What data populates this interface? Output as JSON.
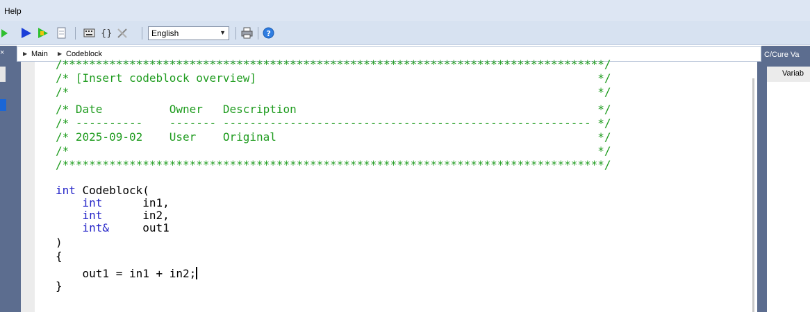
{
  "menubar": {
    "items": [
      "Help"
    ]
  },
  "toolbar": {
    "icons": [
      "play-green-icon",
      "play-blue-icon",
      "step-icon",
      "document-icon",
      "keyboard-icon",
      "braces-icon",
      "tools-icon",
      "printer-icon",
      "help-icon"
    ],
    "language": {
      "selected": "English"
    }
  },
  "breadcrumb": {
    "items": [
      "Main",
      "Codeblock"
    ]
  },
  "right_panel": {
    "title": "C/Cure Va",
    "tab": "Variab"
  },
  "editor": {
    "lines": [
      "/*********************************************************************************/",
      "/* [Insert codeblock overview]                                                   */",
      "/*                                                                               */",
      "/* Date          Owner   Description                                             */",
      "/* ----------    ------- ------------------------------------------------------- */",
      "/* 2025-09-02    User    Original                                                */",
      "/*                                                                               */",
      "/*********************************************************************************/",
      "",
      "int Codeblock(",
      "    int      in1,",
      "    int      in2,",
      "    int&     out1",
      ")",
      "{",
      "    out1 = in1 + in2;",
      "}"
    ]
  }
}
